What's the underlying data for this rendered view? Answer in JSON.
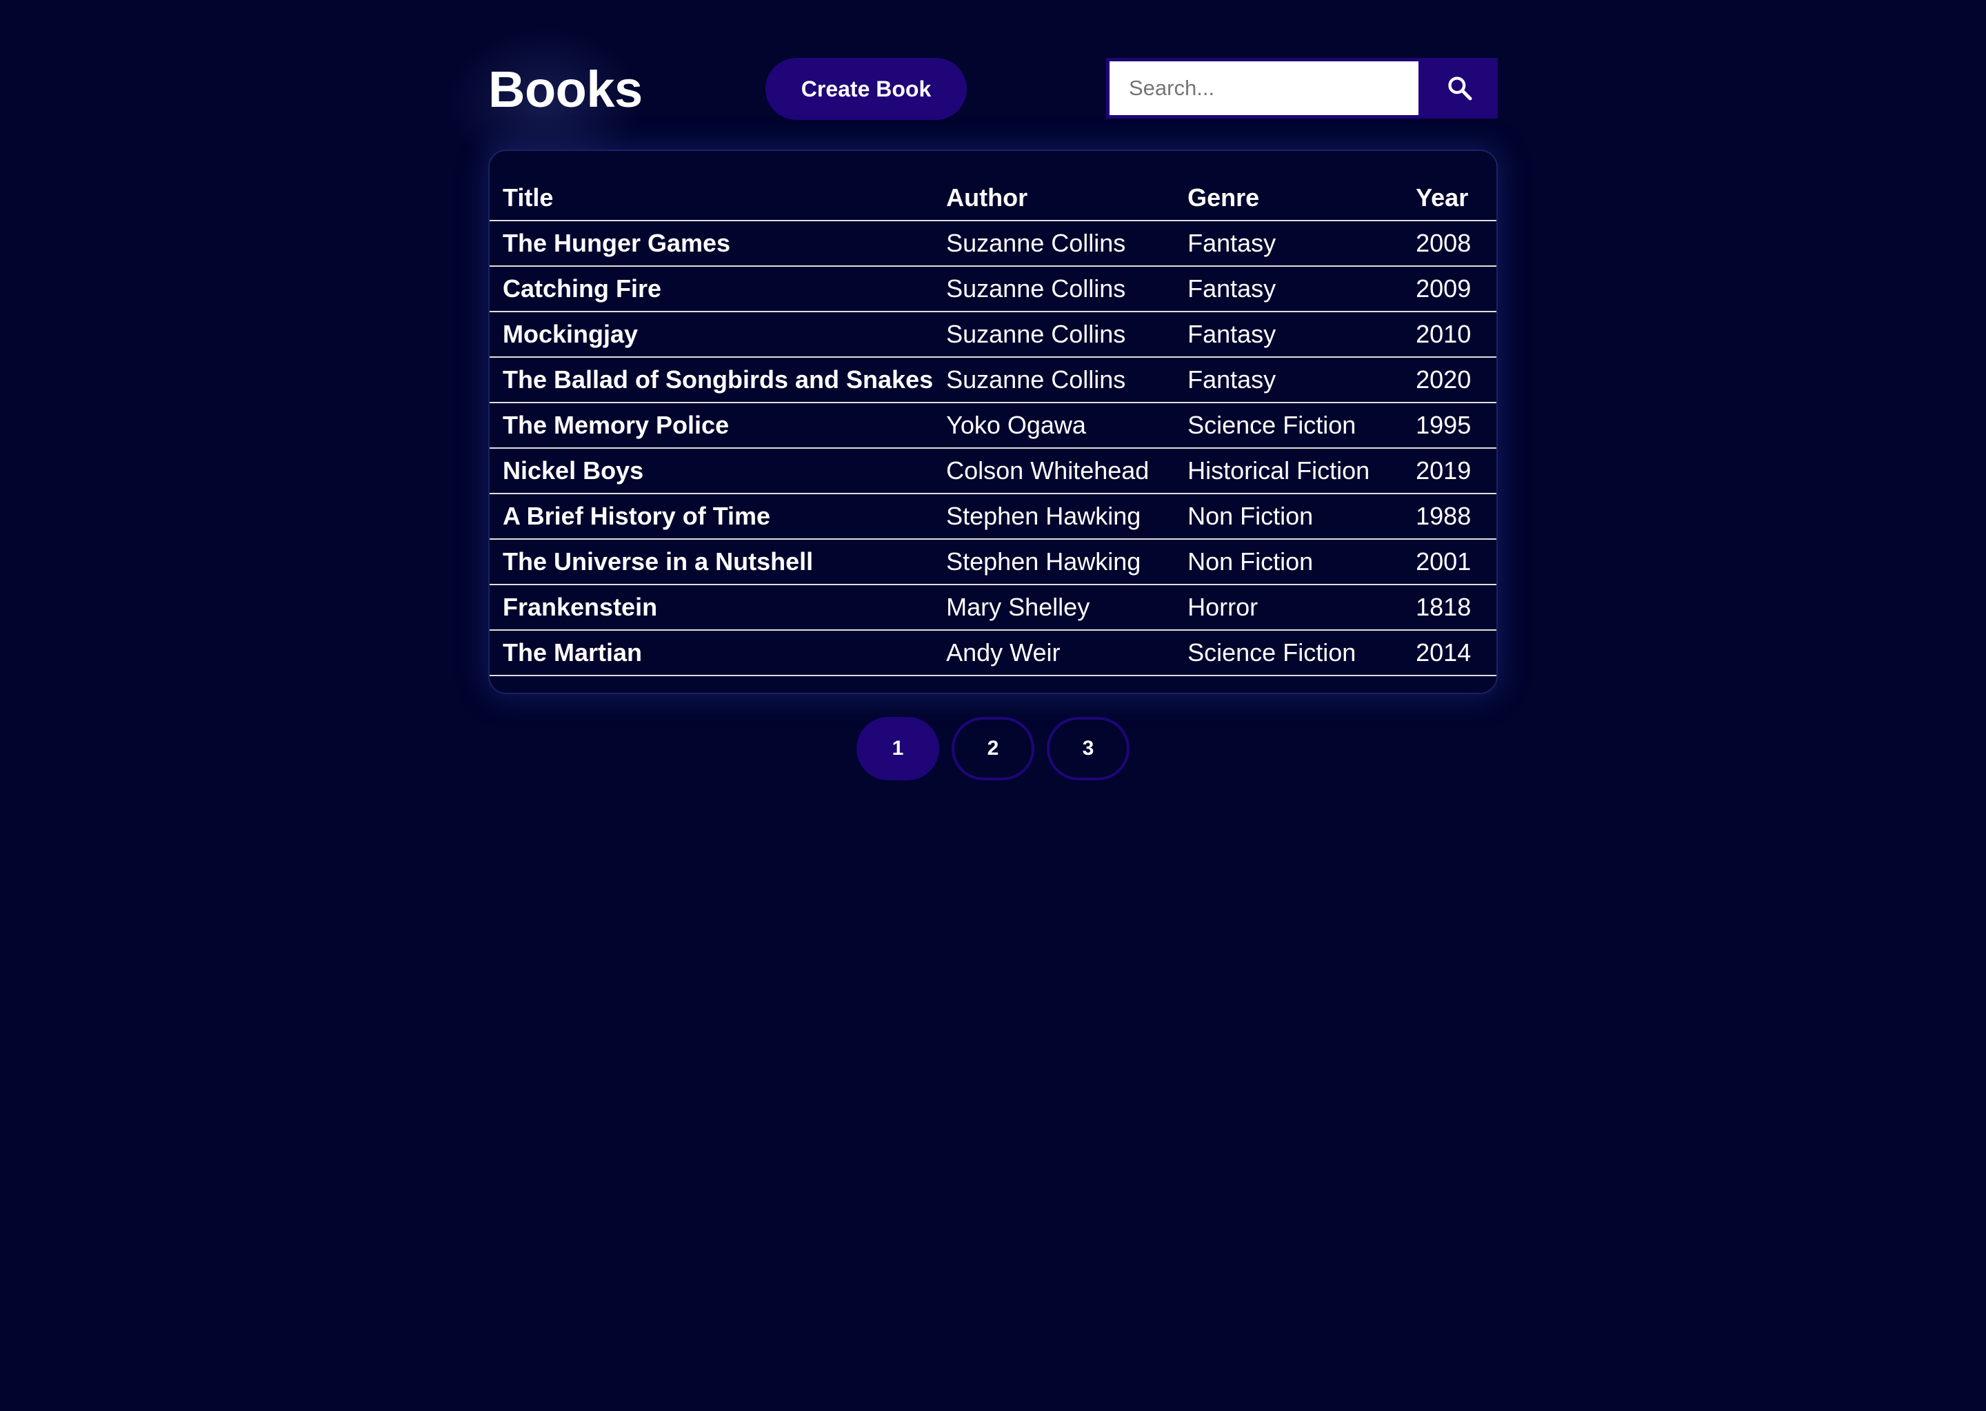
{
  "header": {
    "title": "Books",
    "create_label": "Create Book",
    "search_placeholder": "Search...",
    "search_icon": "search-icon"
  },
  "table": {
    "columns": [
      "Title",
      "Author",
      "Genre",
      "Year"
    ],
    "rows": [
      [
        "The Hunger Games",
        "Suzanne Collins",
        "Fantasy",
        "2008"
      ],
      [
        "Catching Fire",
        "Suzanne Collins",
        "Fantasy",
        "2009"
      ],
      [
        "Mockingjay",
        "Suzanne Collins",
        "Fantasy",
        "2010"
      ],
      [
        "The Ballad of Songbirds and Snakes",
        "Suzanne Collins",
        "Fantasy",
        "2020"
      ],
      [
        "The Memory Police",
        "Yoko Ogawa",
        "Science Fiction",
        "1995"
      ],
      [
        "Nickel Boys",
        "Colson Whitehead",
        "Historical Fiction",
        "2019"
      ],
      [
        "A Brief History of Time",
        "Stephen Hawking",
        "Non Fiction",
        "1988"
      ],
      [
        "The Universe in a Nutshell",
        "Stephen Hawking",
        "Non Fiction",
        "2001"
      ],
      [
        "Frankenstein",
        "Mary Shelley",
        "Horror",
        "1818"
      ],
      [
        "The Martian",
        "Andy Weir",
        "Science Fiction",
        "2014"
      ]
    ]
  },
  "pagination": {
    "pages": [
      "1",
      "2",
      "3"
    ],
    "current": "1"
  },
  "colors": {
    "background": "#01042d",
    "accent": "#1f0578",
    "text": "#ffffff"
  }
}
